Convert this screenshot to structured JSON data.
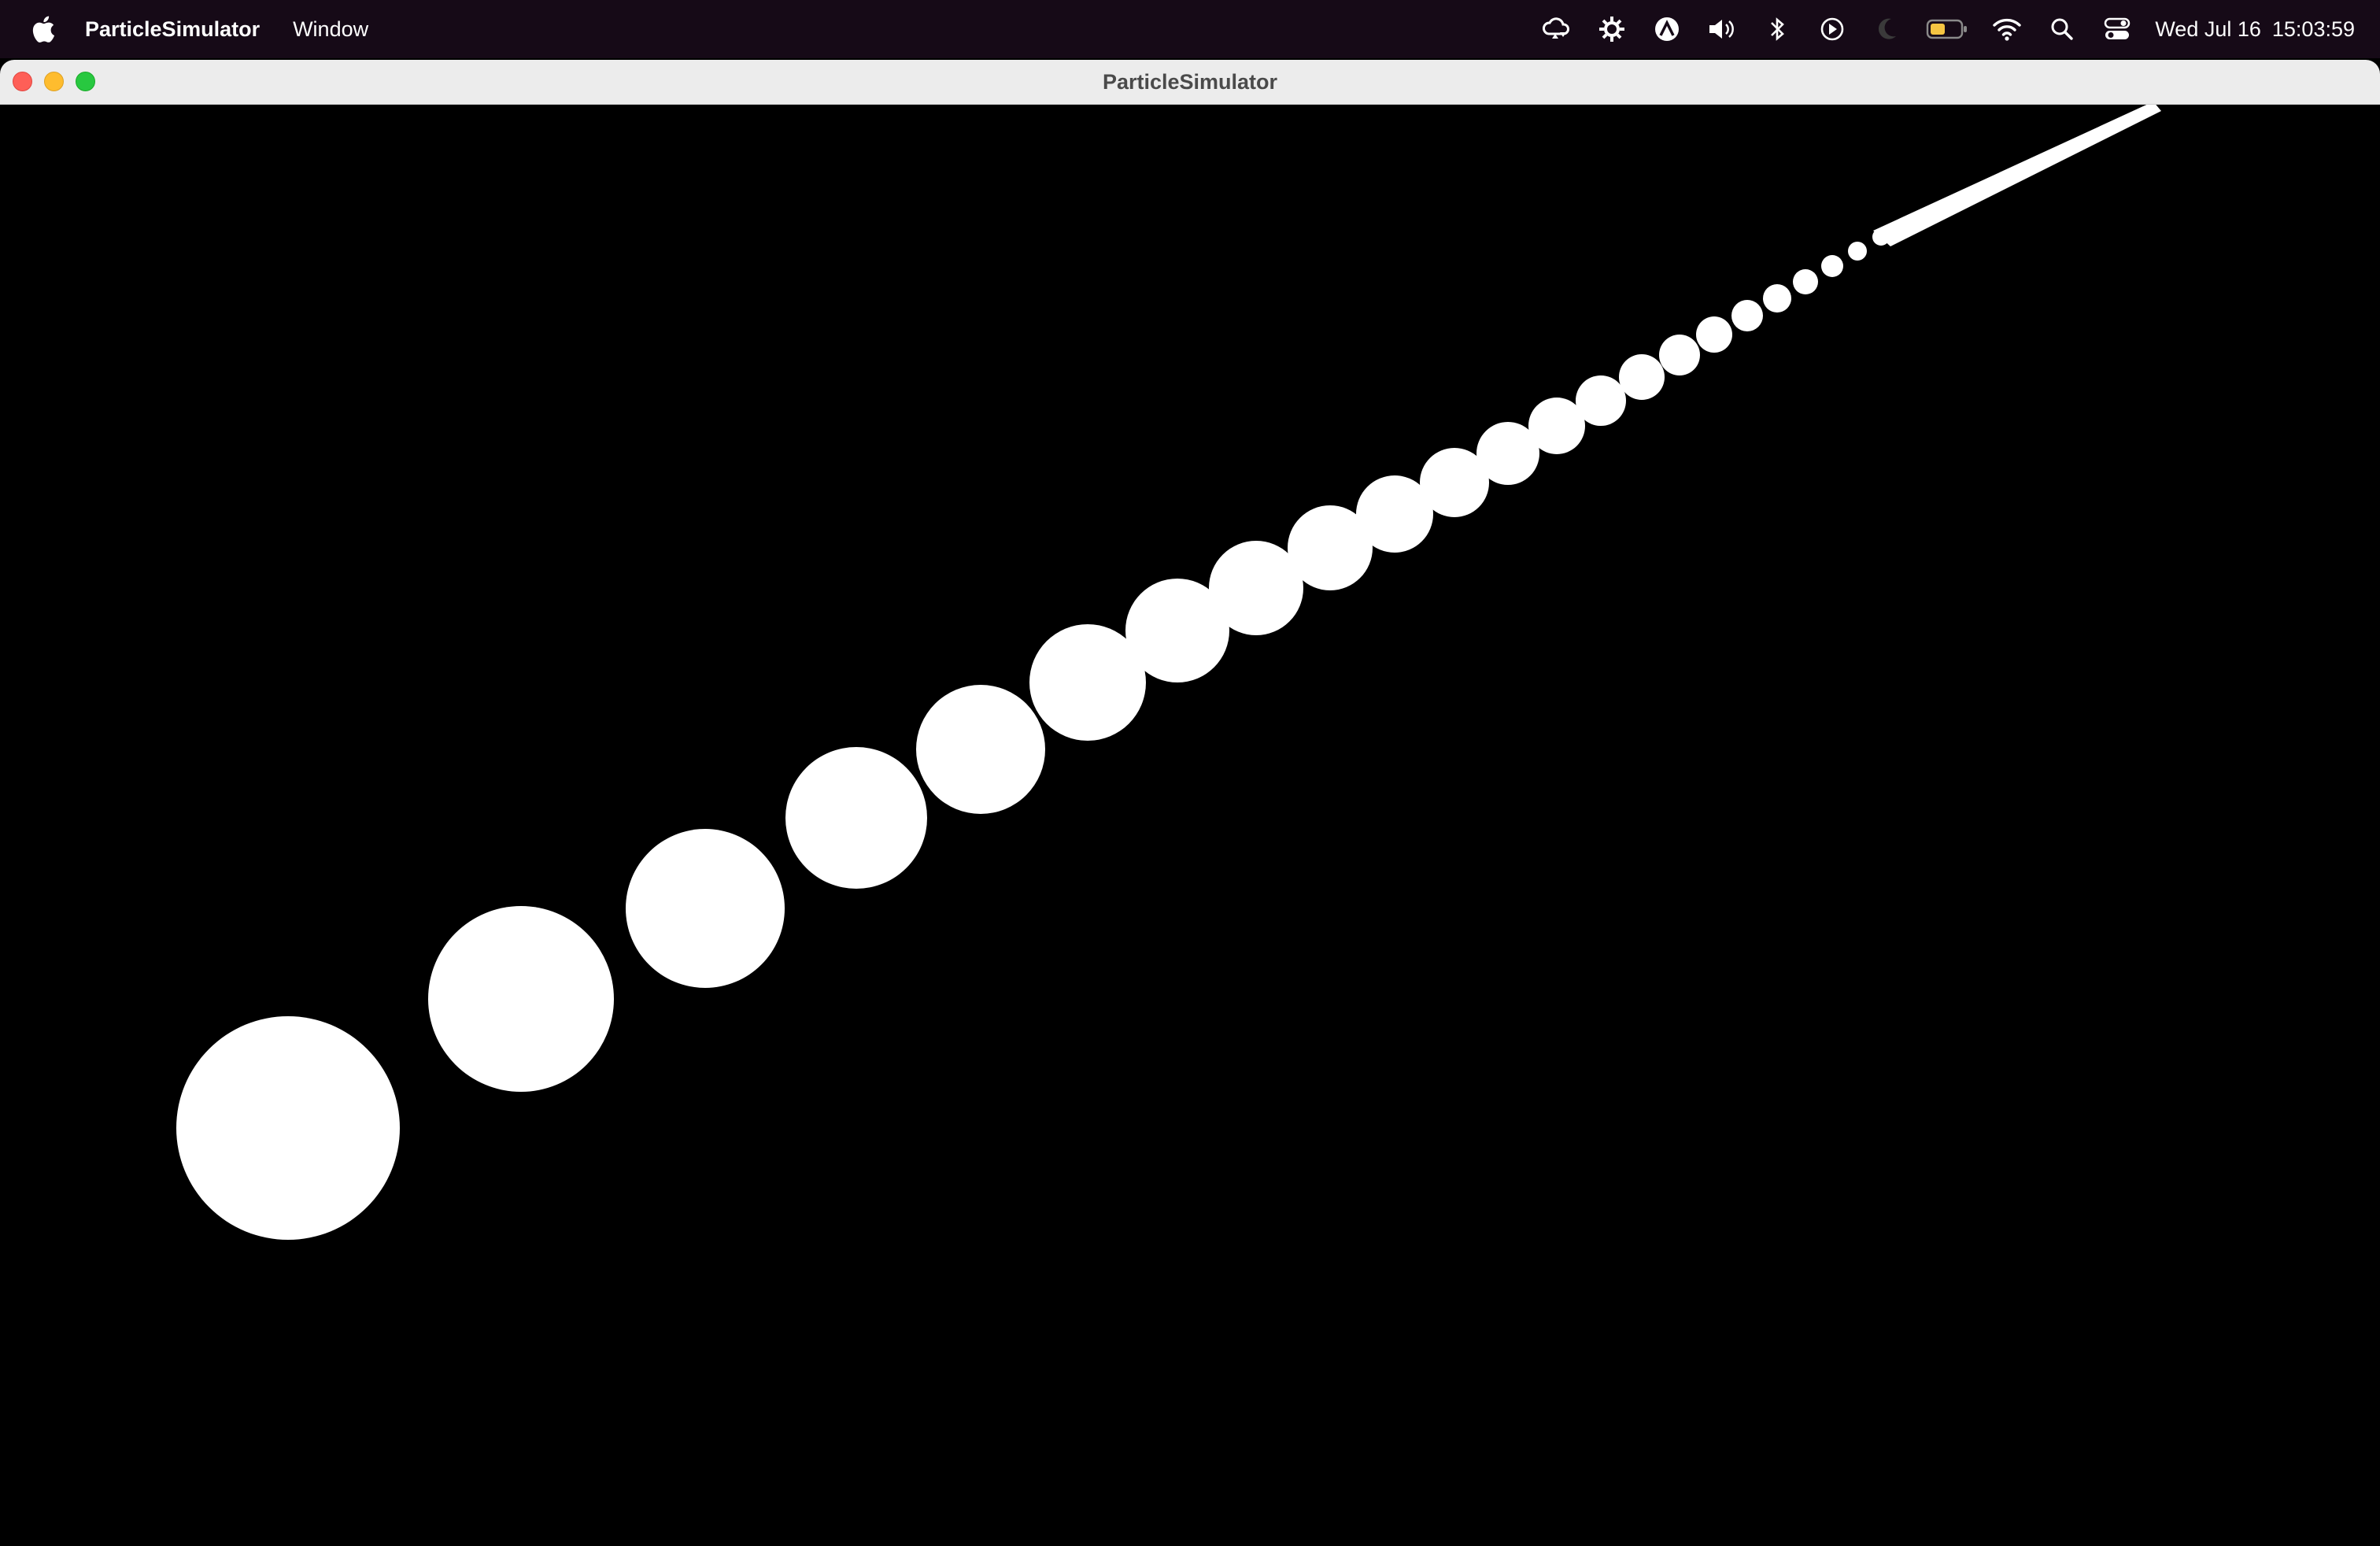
{
  "menubar": {
    "apple_icon": "apple-logo-icon",
    "app_name": "ParticleSimulator",
    "items": [
      "Window"
    ],
    "status_icons": [
      "cloud-sync-icon",
      "network-gear-icon",
      "vpn-shield-icon",
      "volume-icon",
      "bluetooth-icon",
      "play-circle-icon",
      "moon-icon",
      "battery-icon",
      "wifi-icon",
      "search-icon",
      "control-center-icon"
    ],
    "date": "Wed Jul 16",
    "time": "15:03:59"
  },
  "window": {
    "title": "ParticleSimulator",
    "traffic_lights": [
      "close",
      "minimize",
      "zoom"
    ],
    "background": "#000000",
    "particle_color": "#ffffff"
  },
  "colors": {
    "menubar_bg": "#160a17",
    "titlebar_bg": "#ececec",
    "close": "#fe5f57",
    "minimize": "#febc2e",
    "zoom": "#28c840",
    "battery_level_color": "#f5c542"
  }
}
